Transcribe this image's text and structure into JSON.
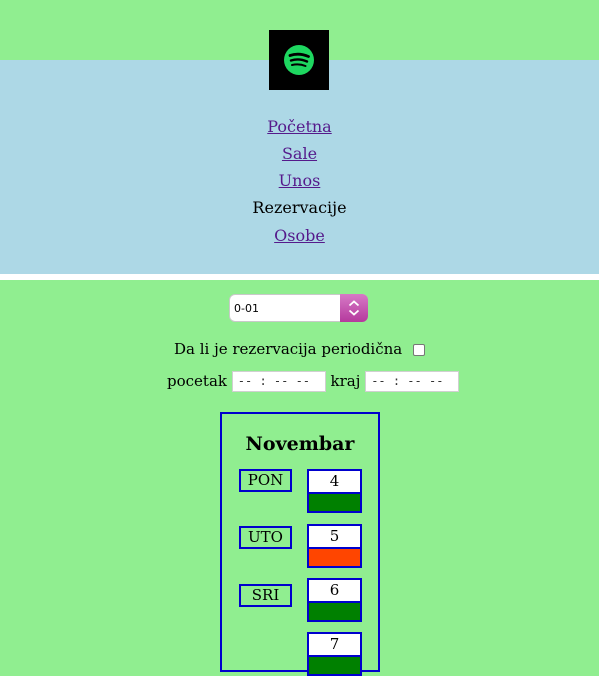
{
  "header": {
    "logo_icon": "spotify-logo-icon",
    "colors": {
      "page": "#90ee90",
      "nav": "#add8e6",
      "logo_bg": "#000000",
      "logo_fg": "#1ed760"
    }
  },
  "nav": {
    "items": [
      {
        "label": "Početna",
        "link": true
      },
      {
        "label": "Sale",
        "link": true
      },
      {
        "label": "Unos",
        "link": true
      },
      {
        "label": "Rezervacije",
        "link": false
      },
      {
        "label": "Osobe",
        "link": true
      }
    ]
  },
  "form": {
    "hall_select_value": "0-01",
    "periodic_label": "Da li je rezervacija periodična",
    "periodic_checked": false,
    "start_label": "pocetak",
    "start_value": "-- : --   --",
    "end_label": "kraj",
    "end_value": "-- : --   --"
  },
  "calendar": {
    "month": "Novembar",
    "days": [
      {
        "label": "PON",
        "num": "4",
        "status_color": "#008000"
      },
      {
        "label": "UTO",
        "num": "5",
        "status_color": "#ff4500"
      },
      {
        "label": "SRI",
        "num": "6",
        "status_color": "#008000"
      },
      {
        "label": "",
        "num": "7",
        "status_color": "#008000"
      }
    ]
  }
}
